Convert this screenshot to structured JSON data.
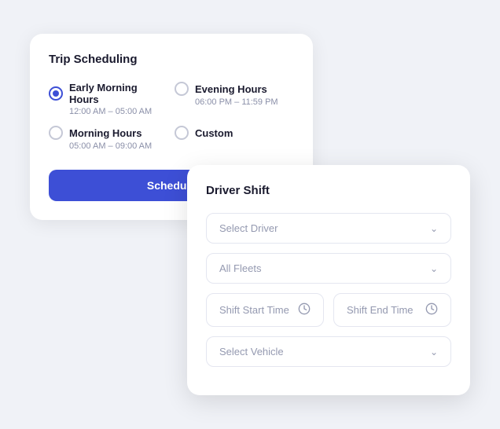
{
  "trip_card": {
    "title": "Trip Scheduling",
    "radio_options": [
      {
        "id": "early_morning",
        "label": "Early Morning Hours",
        "sublabel": "12:00 AM – 05:00 AM",
        "selected": true
      },
      {
        "id": "evening",
        "label": "Evening Hours",
        "sublabel": "06:00 PM – 11:59 PM",
        "selected": false
      },
      {
        "id": "morning",
        "label": "Morning Hours",
        "sublabel": "05:00 AM – 09:00 AM",
        "selected": false
      },
      {
        "id": "custom",
        "label": "Custom",
        "sublabel": "",
        "selected": false
      }
    ],
    "schedule_button": "Schedule"
  },
  "driver_card": {
    "title": "Driver Shift",
    "select_driver_placeholder": "Select Driver",
    "select_fleet_placeholder": "All Fleets",
    "shift_start_placeholder": "Shift Start Time",
    "shift_end_placeholder": "Shift End Time",
    "select_vehicle_placeholder": "Select Vehicle"
  },
  "icons": {
    "chevron_down": "⌄",
    "clock": "🕐"
  }
}
